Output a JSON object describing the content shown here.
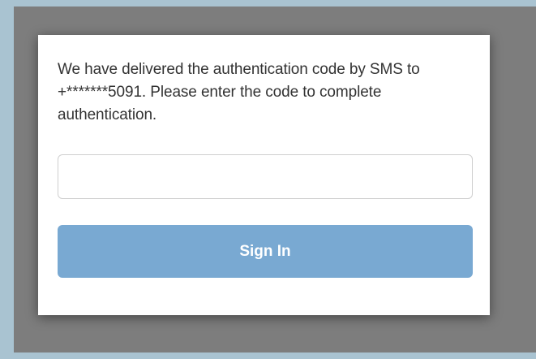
{
  "auth": {
    "message": "We have delivered the authentication code by SMS to +*******5091. Please enter the code to complete authentication.",
    "code_input": {
      "value": "",
      "placeholder": ""
    },
    "signin_label": "Sign In"
  },
  "colors": {
    "page_background": "#a9c3d1",
    "overlay": "#7d7d7d",
    "modal_background": "#ffffff",
    "button": "#79a9d2",
    "button_text": "#ffffff",
    "text": "#333333"
  }
}
